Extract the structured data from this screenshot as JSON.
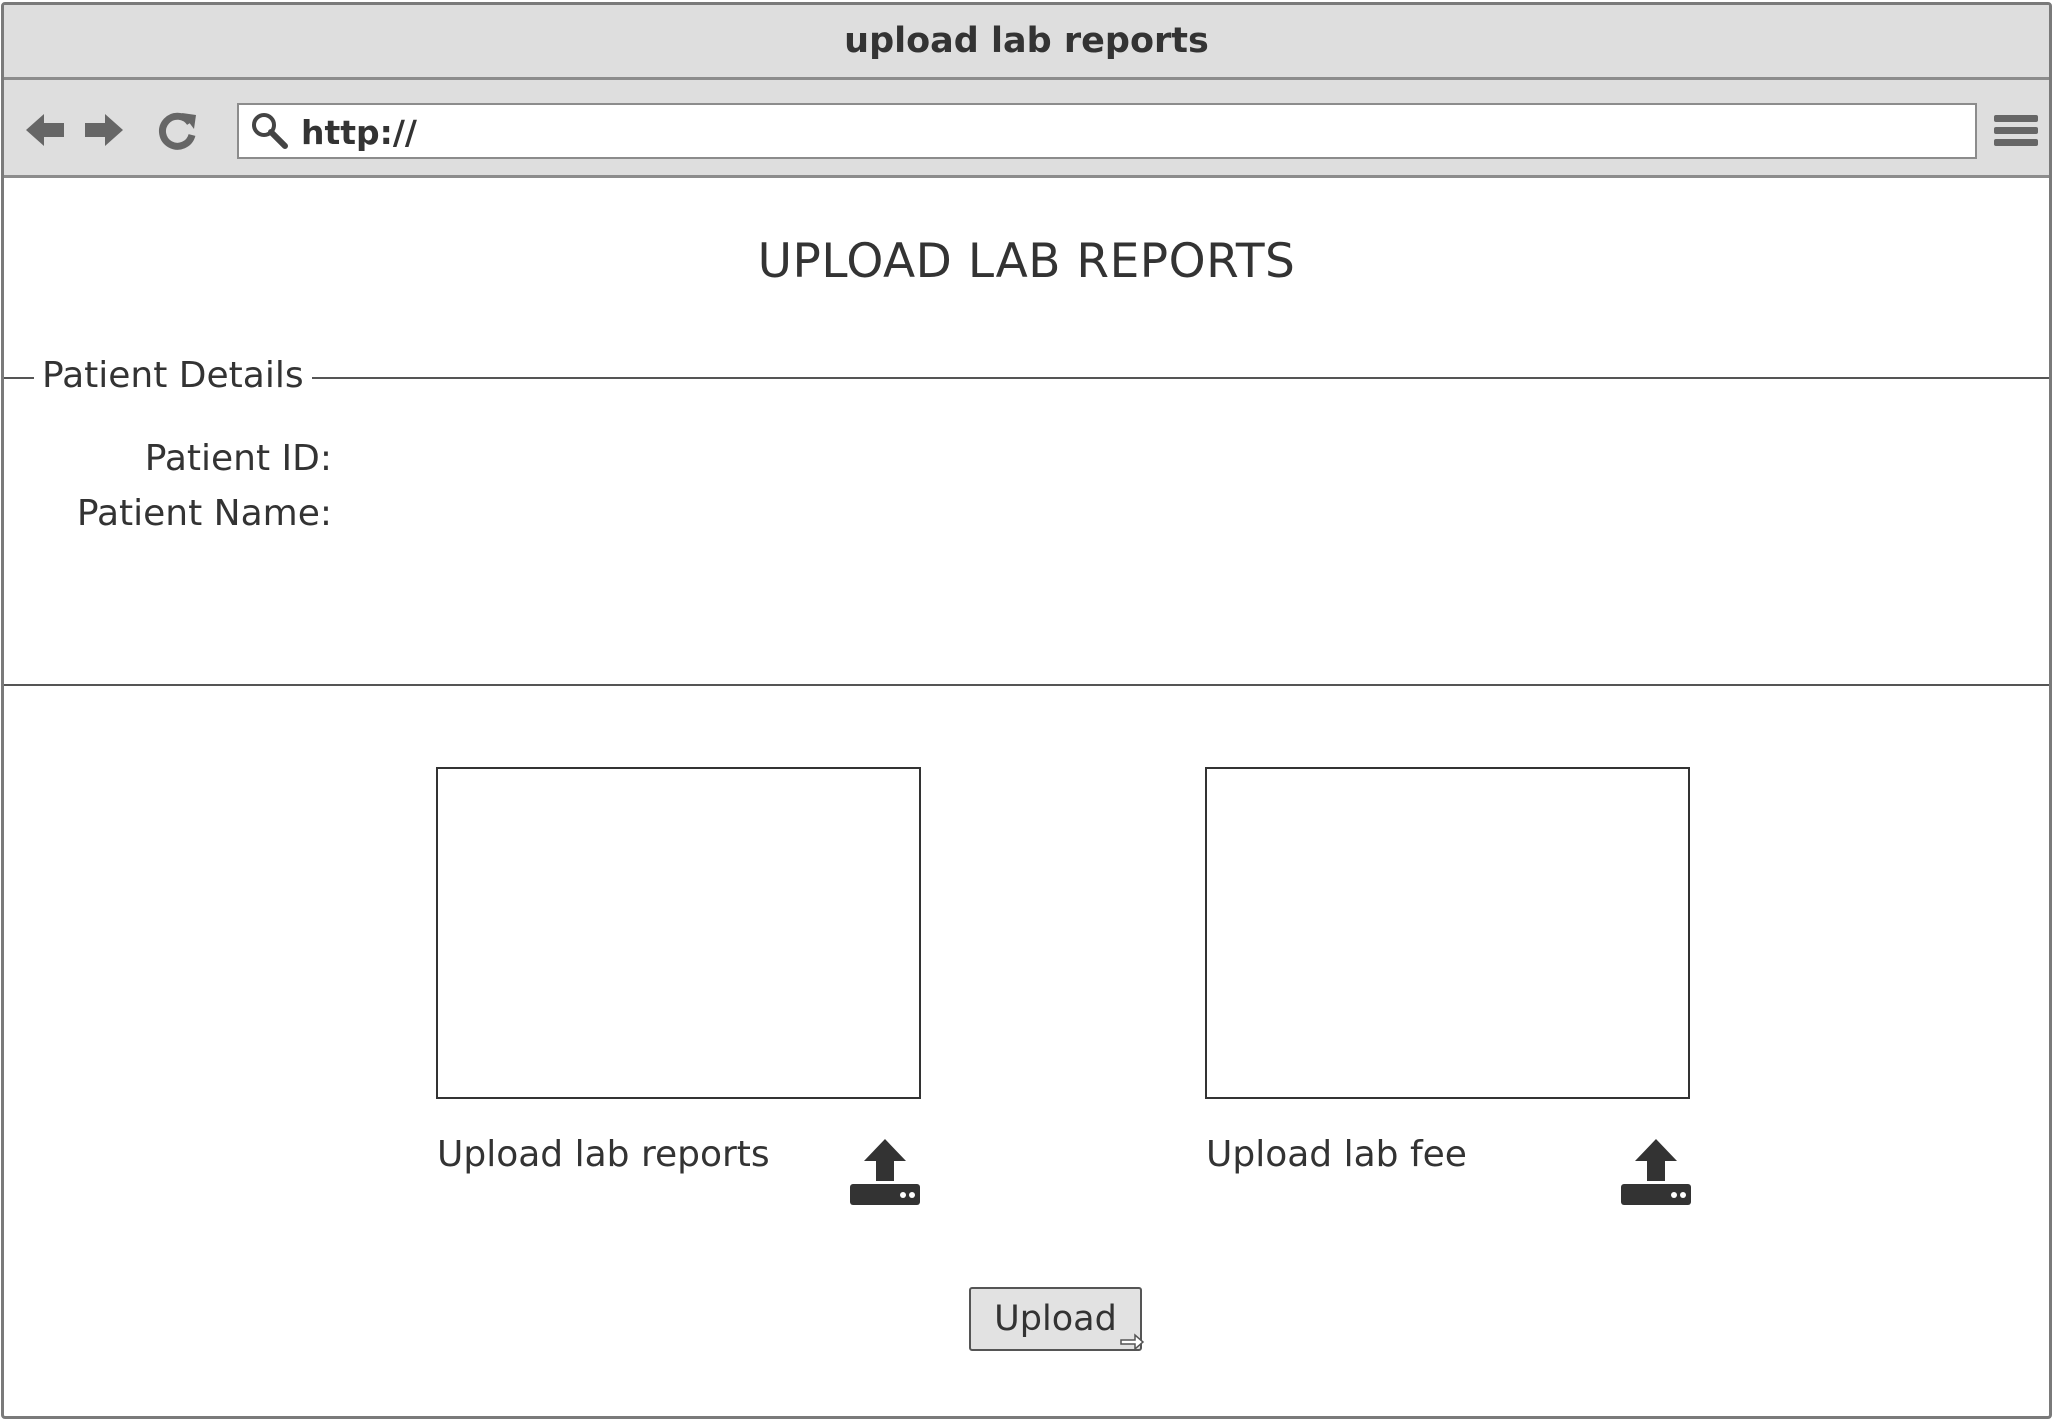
{
  "window": {
    "title": "upload lab reports"
  },
  "browser": {
    "url": "http://",
    "icons": {
      "back": "back-arrow-icon",
      "forward": "forward-arrow-icon",
      "reload": "reload-icon",
      "search": "search-icon",
      "menu": "hamburger-menu-icon"
    }
  },
  "page": {
    "title": "UPLOAD LAB REPORTS",
    "patient_details": {
      "legend": "Patient Details",
      "id_label": "Patient ID:",
      "name_label": "Patient Name:"
    },
    "uploads": [
      {
        "label": "Upload lab reports",
        "icon": "upload-icon"
      },
      {
        "label": "Upload lab fee",
        "icon": "upload-icon"
      }
    ],
    "upload_button": "Upload"
  },
  "colors": {
    "chrome_bg": "#dedede",
    "border": "#8c8c8c",
    "text": "#333333",
    "button_bg": "#e2e2e2"
  }
}
